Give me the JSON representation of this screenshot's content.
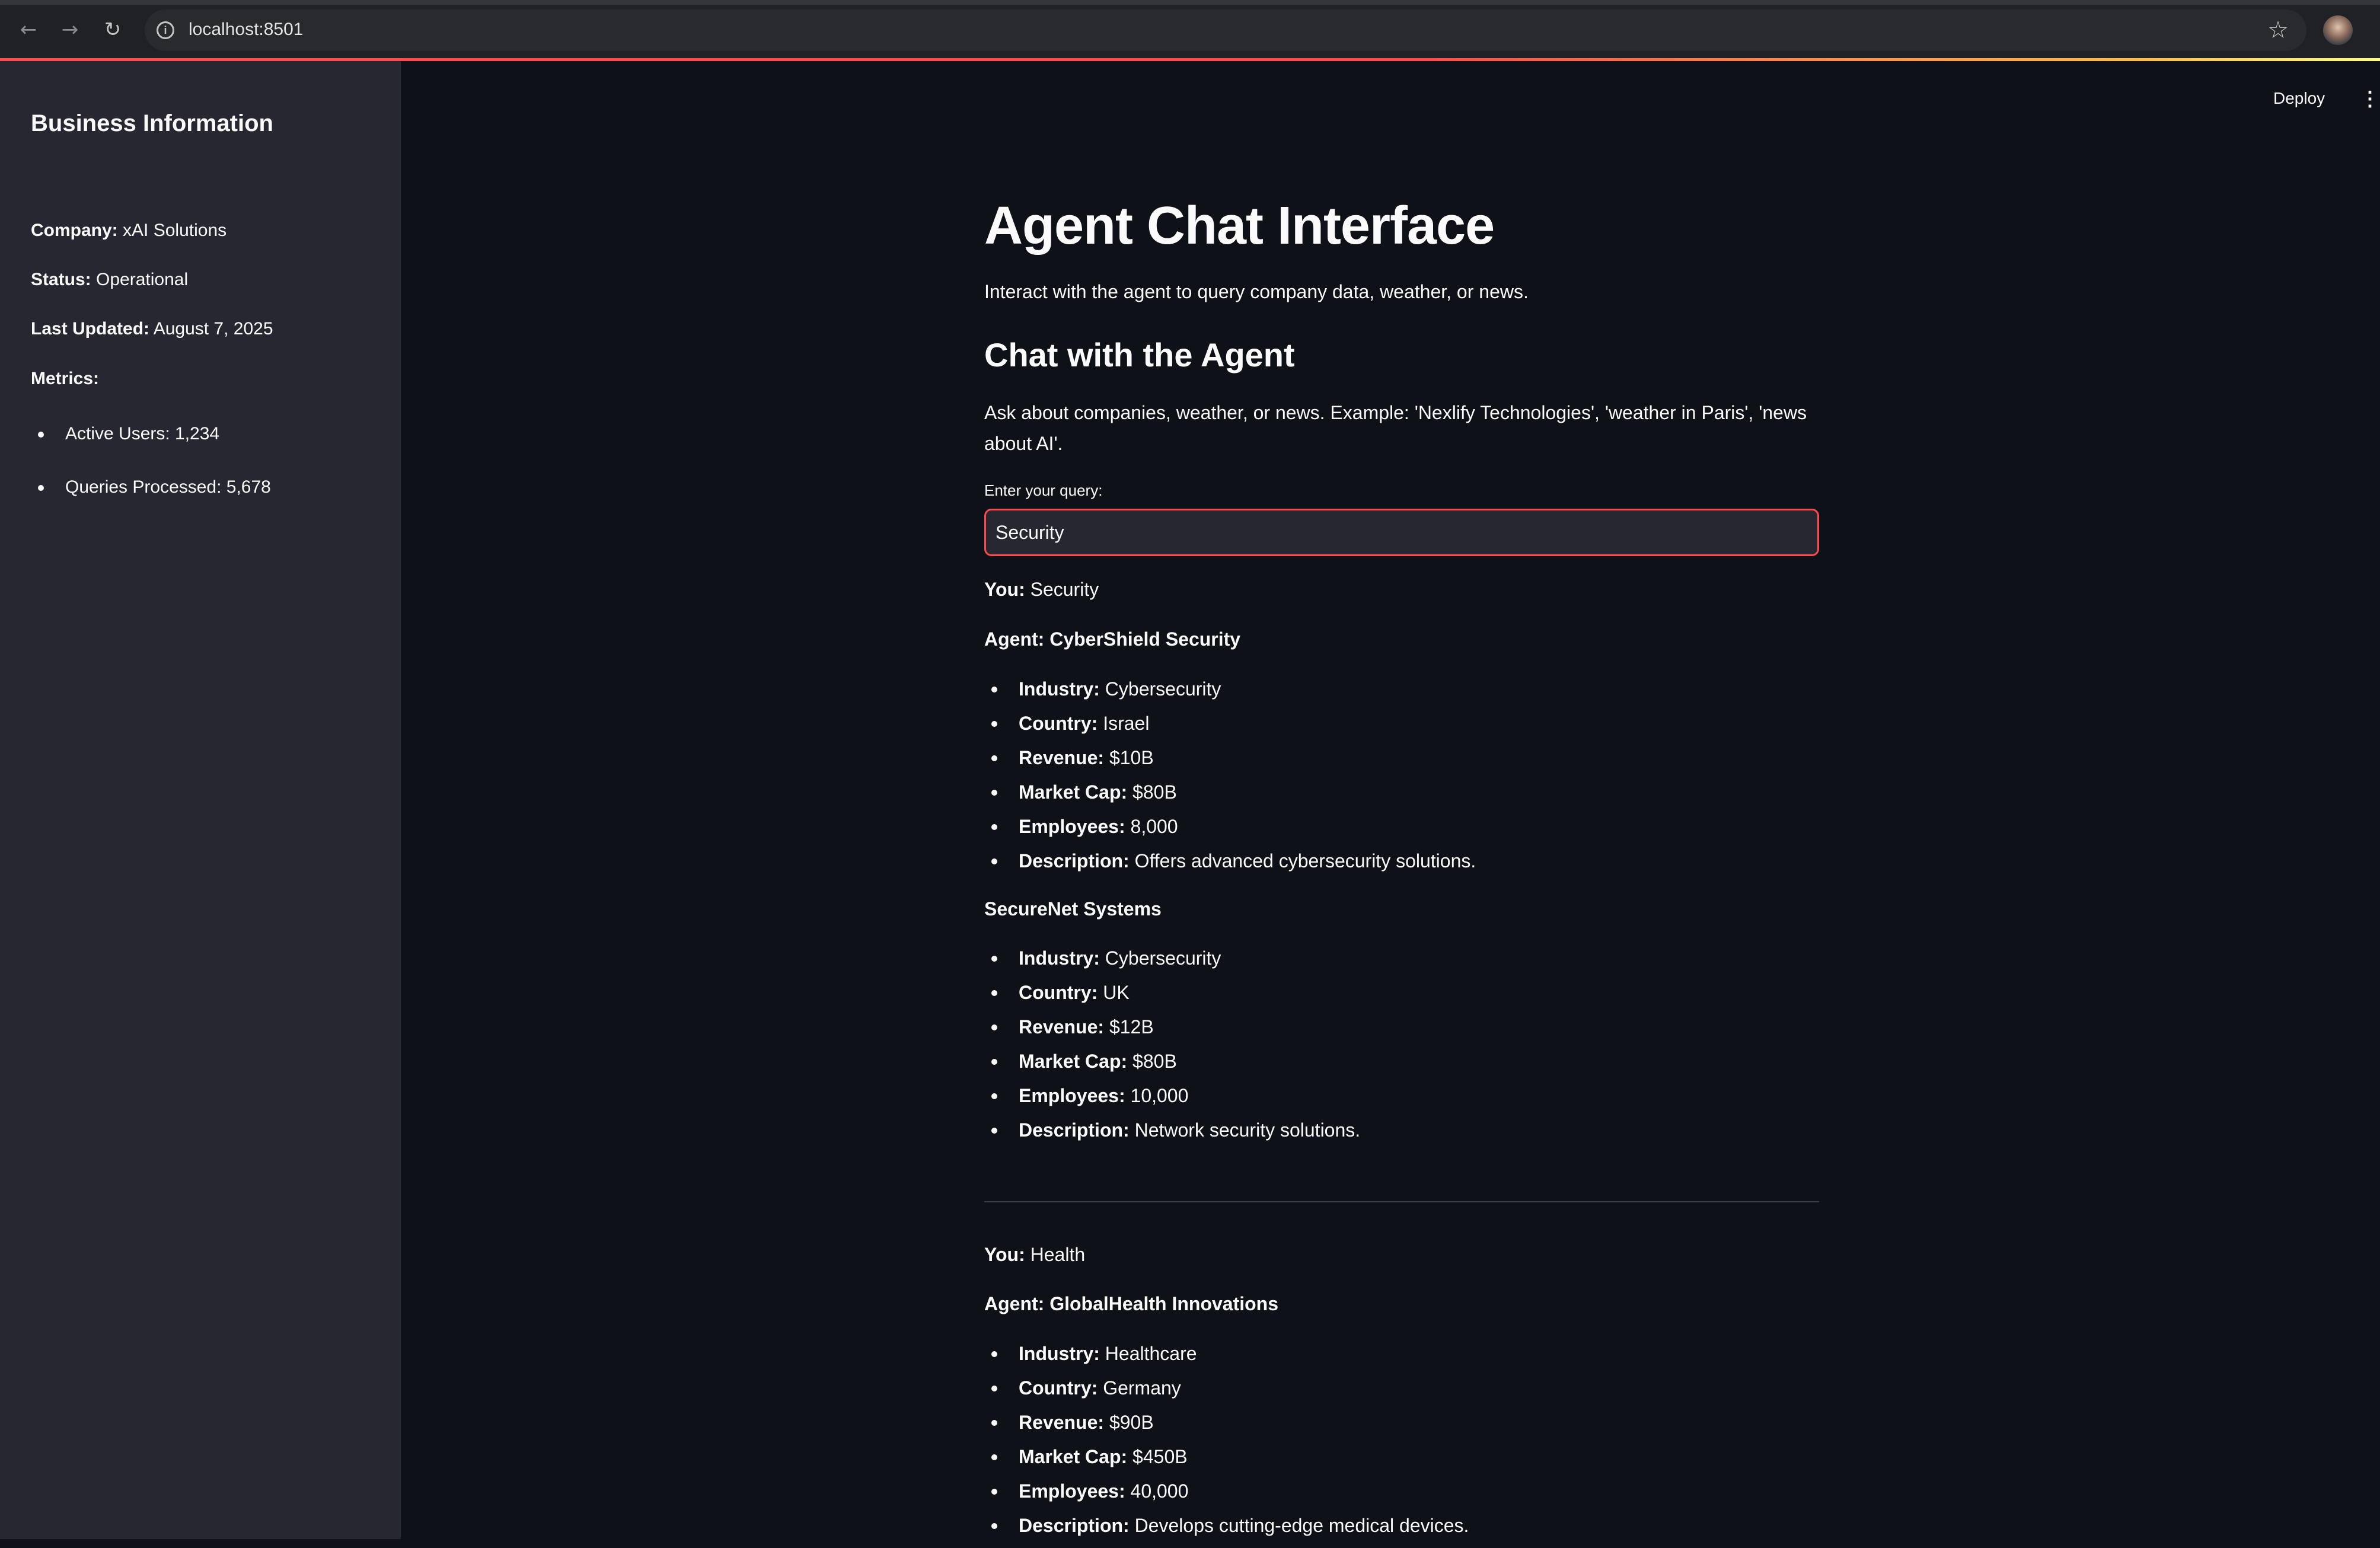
{
  "browser": {
    "url": "localhost:8501"
  },
  "header": {
    "deploy_label": "Deploy"
  },
  "sidebar": {
    "title": "Business Information",
    "company_label": "Company:",
    "company_value": "xAI Solutions",
    "status_label": "Status:",
    "status_value": "Operational",
    "updated_label": "Last Updated:",
    "updated_value": "August 7, 2025",
    "metrics_label": "Metrics:",
    "metrics": [
      "Active Users: 1,234",
      "Queries Processed: 5,678"
    ]
  },
  "main": {
    "title": "Agent Chat Interface",
    "subtitle": "Interact with the agent to query company data, weather, or news.",
    "chat_heading": "Chat with the Agent",
    "chat_description": "Ask about companies, weather, or news. Example: 'Nexlify Technologies', 'weather in Paris', 'news about AI'.",
    "input_label": "Enter your query:",
    "input_value": "Security"
  },
  "labels": {
    "you": "You:",
    "industry": "Industry:",
    "country": "Country:",
    "revenue": "Revenue:",
    "market_cap": "Market Cap:",
    "employees": "Employees:",
    "description": "Description:"
  },
  "conversation": [
    {
      "user_query": "Security",
      "companies": [
        {
          "name": "Agent: CyberShield Security",
          "industry": "Cybersecurity",
          "country": "Israel",
          "revenue": "$10B",
          "market_cap": "$80B",
          "employees": "8,000",
          "description": "Offers advanced cybersecurity solutions."
        },
        {
          "name": "SecureNet Systems",
          "industry": "Cybersecurity",
          "country": "UK",
          "revenue": "$12B",
          "market_cap": "$80B",
          "employees": "10,000",
          "description": "Network security solutions."
        }
      ]
    },
    {
      "user_query": "Health",
      "companies": [
        {
          "name": "Agent: GlobalHealth Innovations",
          "industry": "Healthcare",
          "country": "Germany",
          "revenue": "$90B",
          "market_cap": "$450B",
          "employees": "40,000",
          "description": "Develops cutting-edge medical devices."
        }
      ]
    }
  ]
}
